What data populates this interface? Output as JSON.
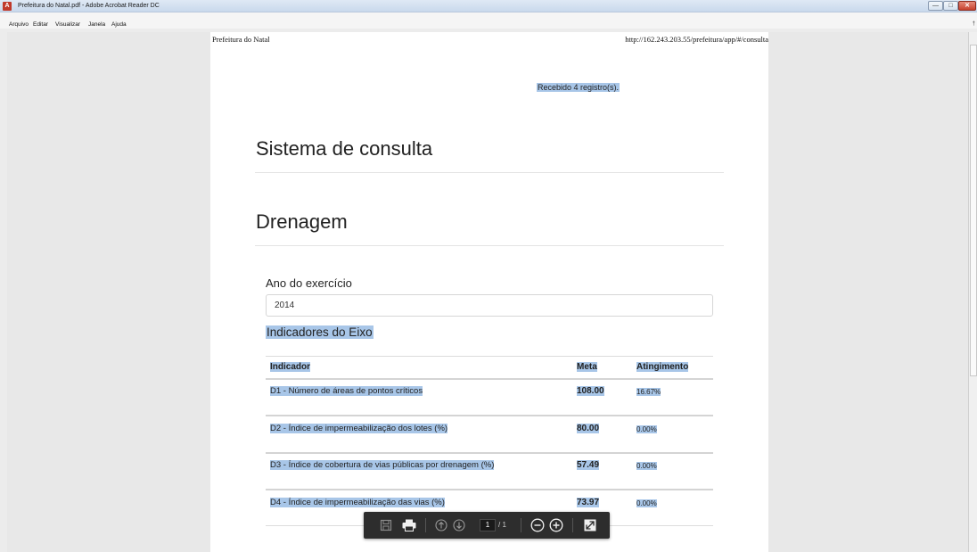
{
  "window": {
    "title": "Prefeitura do Natal.pdf - Adobe Acrobat Reader DC",
    "app_icon_glyph": "A",
    "controls": {
      "minimize": "—",
      "maximize": "□",
      "close": "✕"
    }
  },
  "menu": {
    "items": [
      "Arquivo",
      "Editar",
      "Visualizar",
      "Janela",
      "Ajuda"
    ],
    "hint": "†"
  },
  "page": {
    "header_left": "Prefeitura do Natal",
    "header_right": "http://162.243.203.55/prefeitura/app/#/consulta",
    "received": "Recebido 4 registro(s).",
    "title": "Sistema de consulta",
    "section": "Drenagem",
    "ano_label": "Ano do exercício",
    "ano_value": "2014",
    "indicadores_heading": "Indicadores do Eixo",
    "table": {
      "headers": [
        "Indicador",
        "Meta",
        "Atingimento"
      ],
      "rows": [
        {
          "indicador": "D1 - Número de áreas de pontos críticos",
          "meta": "108.00",
          "atingimento": "16.67%"
        },
        {
          "indicador": "D2 - Índice de impermeabilização dos lotes (%)",
          "meta": "80.00",
          "atingimento": "0.00%"
        },
        {
          "indicador": "D3 - Índice de cobertura de vias públicas por drenagem (%)",
          "meta": "57.49",
          "atingimento": "0.00%"
        },
        {
          "indicador": "D4 - Índice de impermeabilização das vias (%)",
          "meta": "73.97",
          "atingimento": "0.00%"
        }
      ]
    }
  },
  "toolbar": {
    "page_current": "1",
    "page_total": "/ 1",
    "icons": [
      "save-icon",
      "print-icon",
      "page-up-icon",
      "page-down-icon",
      "zoom-out-icon",
      "zoom-in-icon",
      "fit-page-icon"
    ]
  },
  "colors": {
    "highlight": "#a8c6e8",
    "toolbar_bg": "#2d2d2d"
  }
}
